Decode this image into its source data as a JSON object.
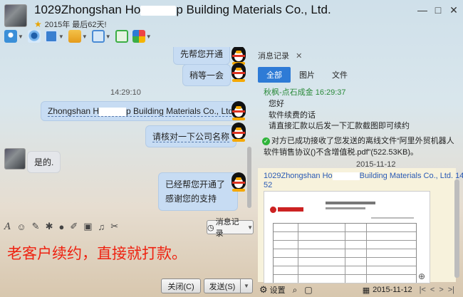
{
  "header": {
    "title": "1029Zhongshan Hong Kong Building Materials Co., Ltd.",
    "title_visible": "1029Zhongshan Ho",
    "title_tail": "p Building Materials Co., Ltd.",
    "subtitle": "2015年 最后62天!",
    "window_controls": [
      "—",
      "□",
      "✕"
    ]
  },
  "chat": {
    "partial_top": "先帮您开通",
    "msg1": "稍等一会",
    "timestamp": "14:29:10",
    "msg2_prefix": "Zhongshan H",
    "msg2_suffix": "p Building Materials Co., Ltd.",
    "msg3": "请核对一下公司名称",
    "msg4": "是的.",
    "msg5_line1": "已经帮您开通了",
    "msg5_line2": "感谢您的支持"
  },
  "input_toolbar": {
    "history_button": "消息记录"
  },
  "input": {
    "text": "老客户续约，直接就打款。"
  },
  "buttons": {
    "close": "关闭(C)",
    "send": "发送(S)"
  },
  "panel": {
    "tab_label": "消息记录",
    "tabs": [
      "全部",
      "图片",
      "文件"
    ],
    "sender": "秋枫-点石成金 16:29:37",
    "lines": [
      "您好",
      "软件续费的话",
      "请直接汇款以后发一下汇款截图即可续约"
    ],
    "file_line1": "对方已成功接收了您发送的离线文件“阿里外贸机器人",
    "file_line2": "软件销售协议()不含增值税.pdf”(522.53KB)。",
    "date_sep": "2015-11-12",
    "msg2_head": "1029Zhongshan Ho",
    "msg2_head_tail": "Building Materials Co., Ltd. 14:26:",
    "msg2_time": "52",
    "bottom_settings": "设置",
    "bottom_date": "2015-11-12"
  },
  "colors": {
    "accent": "#2e7bd6",
    "bubble_right": "#c7dcf3",
    "bubble_left": "#e4e6ea",
    "input_text": "#ee2211",
    "sender": "#2a8a3a"
  }
}
